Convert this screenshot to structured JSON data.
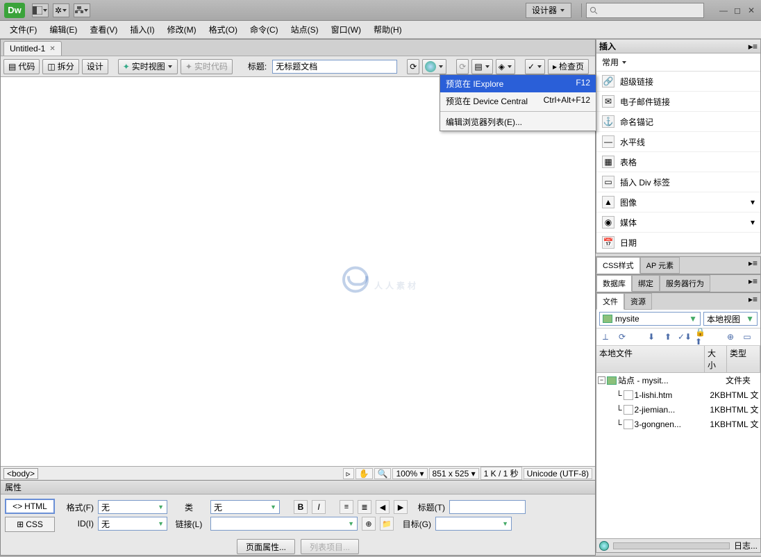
{
  "topbar": {
    "logo": "Dw",
    "designer": "设计器"
  },
  "menu": [
    "文件(F)",
    "编辑(E)",
    "查看(V)",
    "插入(I)",
    "修改(M)",
    "格式(O)",
    "命令(C)",
    "站点(S)",
    "窗口(W)",
    "帮助(H)"
  ],
  "doctab": {
    "name": "Untitled-1"
  },
  "toolbar2": {
    "code": "代码",
    "split": "拆分",
    "design": "设计",
    "liveview": "实时视图",
    "livecode": "实时代码",
    "titlelabel": "标题:",
    "titlevalue": "无标题文档",
    "inspect": "检查页"
  },
  "preview_menu": {
    "item1_label": "预览在 IExplore",
    "item1_sc": "F12",
    "item2_label": "预览在 Device Central",
    "item2_sc": "Ctrl+Alt+F12",
    "item3_label": "编辑浏览器列表(E)..."
  },
  "tagbar": {
    "tag": "<body>",
    "zoom": "100%",
    "dims": "851 x 525",
    "size": "1 K / 1 秒",
    "enc": "Unicode (UTF-8)"
  },
  "props": {
    "title": "属性",
    "html": "HTML",
    "css": "CSS",
    "format": "格式(F)",
    "format_v": "无",
    "class": "类",
    "class_v": "无",
    "id": "ID(I)",
    "id_v": "无",
    "link": "链接(L)",
    "titlef": "标题(T)",
    "target": "目标(G)",
    "pageprops": "页面属性...",
    "listitem": "列表项目..."
  },
  "panels": {
    "insert": {
      "title": "插入",
      "cat": "常用",
      "items": [
        "超级链接",
        "电子邮件链接",
        "命名锚记",
        "水平线",
        "表格",
        "插入 Div 标签",
        "图像",
        "媒体",
        "日期"
      ]
    },
    "css": {
      "t1": "CSS样式",
      "t2": "AP 元素"
    },
    "db": {
      "t1": "数据库",
      "t2": "绑定",
      "t3": "服务器行为"
    },
    "files": {
      "t1": "文件",
      "t2": "资源",
      "site": "mysite",
      "view": "本地视图",
      "h1": "本地文件",
      "h2": "大小",
      "h3": "类型",
      "root": "站点 - mysit...",
      "root_ty": "文件夹",
      "rows": [
        {
          "n": "1-lishi.htm",
          "s": "2KB",
          "t": "HTML 文"
        },
        {
          "n": "2-jiemian...",
          "s": "1KB",
          "t": "HTML 文"
        },
        {
          "n": "3-gongnen...",
          "s": "1KB",
          "t": "HTML 文"
        }
      ],
      "log": "日志..."
    }
  },
  "watermark": "人人素材"
}
